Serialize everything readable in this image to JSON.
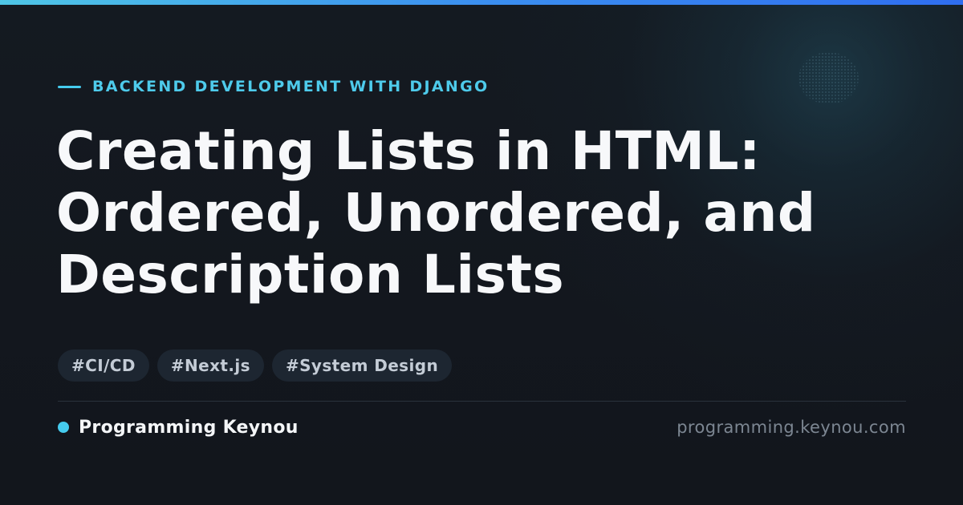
{
  "colors": {
    "accent": "#45cbee",
    "background": "#13171e",
    "title": "#f7f8fa",
    "tag_background": "#1d2631",
    "tag_text": "#c4ccd6",
    "url_text": "#7c8692"
  },
  "category": {
    "label": "BACKEND DEVELOPMENT WITH DJANGO"
  },
  "title": {
    "lines": [
      "Creating Lists in HTML:",
      "Ordered, Unordered, and",
      "Description Lists"
    ]
  },
  "tags": [
    {
      "label": "#CI/CD"
    },
    {
      "label": "#Next.js"
    },
    {
      "label": "#System Design"
    }
  ],
  "footer": {
    "brand_name": "Programming Keynou",
    "url": "programming.keynou.com"
  }
}
